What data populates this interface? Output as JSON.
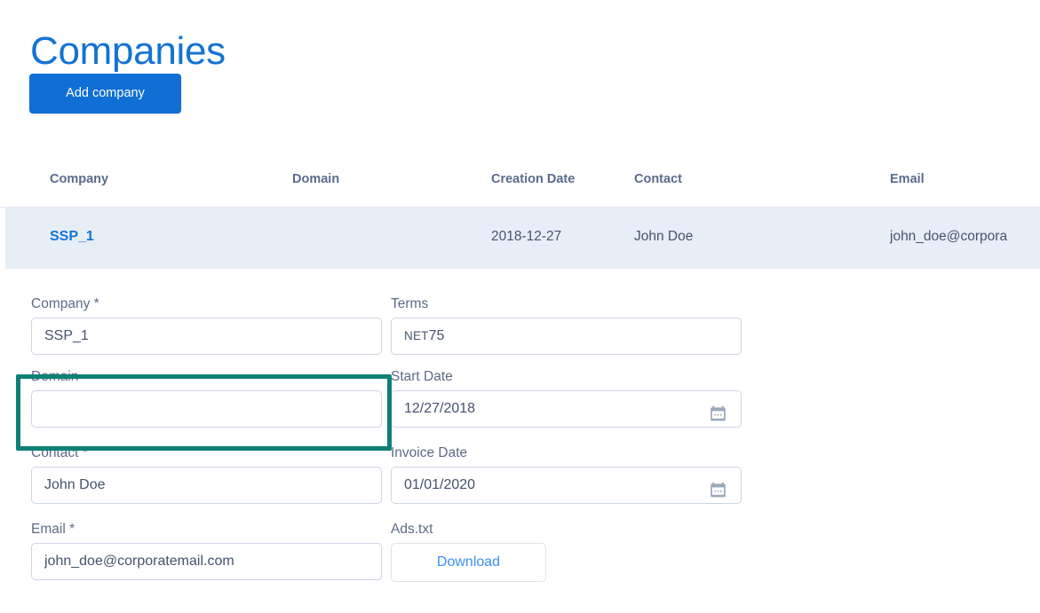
{
  "page": {
    "title": "Companies"
  },
  "toolbar": {
    "add_company_label": "Add company"
  },
  "colors": {
    "accent_blue": "#1473d3",
    "button_blue": "#0f6fd4",
    "selected_row_bg": "#e8eef7",
    "highlight_green": "#0e8074",
    "label_grey": "#5d6b86",
    "header_grey": "#5a6b8c"
  },
  "table": {
    "columns": [
      {
        "key": "company",
        "label": "Company"
      },
      {
        "key": "domain",
        "label": "Domain"
      },
      {
        "key": "creation",
        "label": "Creation Date"
      },
      {
        "key": "contact",
        "label": "Contact"
      },
      {
        "key": "email",
        "label": "Email"
      }
    ],
    "rows": [
      {
        "company": "SSP_1",
        "domain": "",
        "creation": "2018-12-27",
        "contact": "John Doe",
        "email": "john_doe@corpora",
        "selected": true,
        "expanded": true
      }
    ]
  },
  "detail_form": {
    "fields": [
      {
        "name": "company",
        "label": "Company *",
        "value": "SSP_1",
        "placeholder": "",
        "type": "text"
      },
      {
        "name": "terms",
        "label": "Terms",
        "value": "NET 75",
        "placeholder": "",
        "type": "terms"
      },
      {
        "name": "domain",
        "label": "Domain",
        "value": "",
        "placeholder": "",
        "type": "text",
        "highlighted": true
      },
      {
        "name": "start_date",
        "label": "Start Date",
        "value": "12/27/2018",
        "placeholder": "",
        "type": "date"
      },
      {
        "name": "contact",
        "label": "Contact *",
        "value": "John Doe",
        "placeholder": "",
        "type": "text"
      },
      {
        "name": "invoice_date",
        "label": "Invoice Date",
        "value": "01/01/2020",
        "placeholder": "",
        "type": "date"
      },
      {
        "name": "email",
        "label": "Email *",
        "value": "john_doe@corporatemail.com",
        "placeholder": "",
        "type": "text"
      },
      {
        "name": "ads_txt",
        "label": "Ads.txt",
        "value": "Download",
        "placeholder": "",
        "type": "button"
      }
    ],
    "terms_prefix": "NET",
    "terms_number": "75",
    "download_label": "Download",
    "calendar_icon": "calendar-icon"
  }
}
